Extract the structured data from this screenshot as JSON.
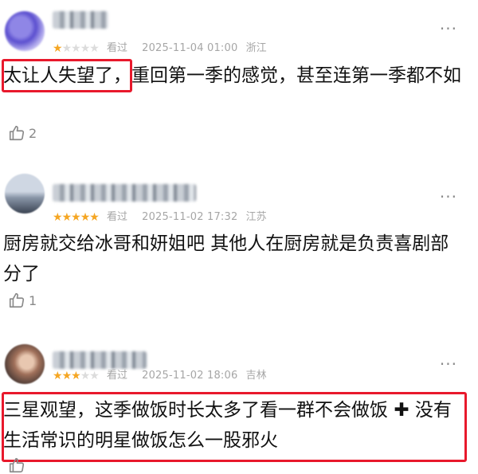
{
  "comments": [
    {
      "stars_filled": 1,
      "stars_total": 5,
      "watched": "看过",
      "timestamp": "2025-11-04 01:00",
      "location": "浙江",
      "highlight": "太让人失望了，",
      "text": "重回第一季的感觉，甚至连第一季都不如",
      "likes": "2"
    },
    {
      "stars_filled": 5,
      "stars_total": 5,
      "watched": "看过",
      "timestamp": "2025-11-02 17:32",
      "location": "江苏",
      "text": "厨房就交给冰哥和妍姐吧 其他人在厨房就是负责喜剧部分了",
      "likes": "1"
    },
    {
      "stars_filled": 3,
      "stars_total": 5,
      "watched": "看过",
      "timestamp": "2025-11-02 18:06",
      "location": "吉林",
      "text_part1": "三星观望，这季做饭时长太多了看一群不会做饭",
      "text_part2": "没有生活常识的明星做饭怎么一股邪火",
      "likes": ""
    }
  ],
  "icons": {
    "more": "more-dots-icon",
    "like": "thumbs-up-icon",
    "star": "star-icon",
    "plus": "plus-icon"
  },
  "colors": {
    "star_on": "#f5a623",
    "star_off": "#dcdcdc",
    "highlight": "#e8192c",
    "meta": "#a6a6a6"
  }
}
